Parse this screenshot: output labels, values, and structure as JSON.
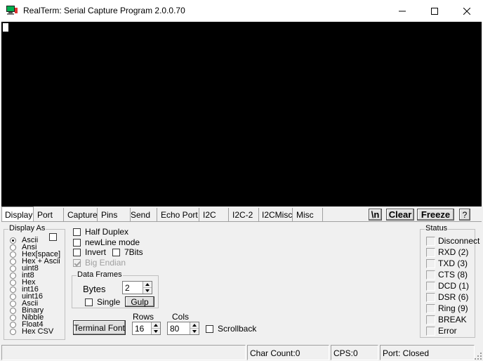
{
  "window": {
    "title": "RealTerm: Serial Capture Program 2.0.0.70"
  },
  "tabs": [
    {
      "label": "Display",
      "active": true
    },
    {
      "label": "Port"
    },
    {
      "label": "Capture"
    },
    {
      "label": "Pins"
    },
    {
      "label": "Send"
    },
    {
      "label": "Echo Port"
    },
    {
      "label": "I2C"
    },
    {
      "label": "I2C-2"
    },
    {
      "label": "I2CMisc"
    },
    {
      "label": "Misc"
    }
  ],
  "toolbar": {
    "newline_label": "\\n",
    "clear_label": "Clear",
    "freeze_label": "Freeze",
    "help_label": "?"
  },
  "display_as": {
    "title": "Display As",
    "options": [
      "Ascii",
      "Ansi",
      "Hex[space]",
      "Hex + Ascii",
      "uint8",
      "int8",
      "Hex",
      "int16",
      "uint16",
      "Ascii",
      "Binary",
      "Nibble",
      "Float4",
      "Hex CSV"
    ],
    "selected": "Ascii"
  },
  "options": {
    "half_duplex": "Half Duplex",
    "newline_mode": "newLine mode",
    "invert": "Invert",
    "seven_bits": "7Bits",
    "big_endian": "Big Endian"
  },
  "data_frames": {
    "title": "Data Frames",
    "bytes_label": "Bytes",
    "bytes_value": "2",
    "single_label": "Single",
    "gulp_label": "Gulp"
  },
  "terminal": {
    "font_button": "Terminal Font",
    "rows_label": "Rows",
    "rows_value": "16",
    "cols_label": "Cols",
    "cols_value": "80",
    "scrollback_label": "Scrollback"
  },
  "status": {
    "title": "Status",
    "items": [
      "Disconnect",
      "RXD (2)",
      "TXD (3)",
      "CTS (8)",
      "DCD (1)",
      "DSR (6)",
      "Ring (9)",
      "BREAK",
      "Error"
    ]
  },
  "statusbar": {
    "char_count": "Char Count:0",
    "cps": "CPS:0",
    "port": "Port: Closed"
  }
}
